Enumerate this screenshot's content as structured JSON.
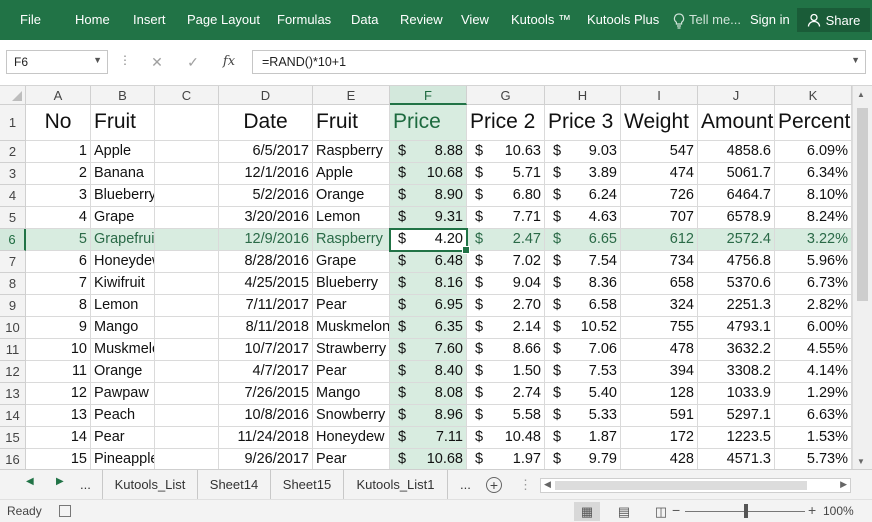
{
  "ribbon": {
    "tabs": [
      "File",
      "Home",
      "Insert",
      "Page Layout",
      "Formulas",
      "Data",
      "Review",
      "View",
      "Kutools ™",
      "Kutools Plus"
    ],
    "tell_me": "Tell me...",
    "sign_in": "Sign in",
    "share": "Share"
  },
  "formula_bar": {
    "name_box": "F6",
    "formula": "=RAND()*10+1"
  },
  "grid": {
    "columns": [
      "A",
      "B",
      "C",
      "D",
      "E",
      "F",
      "G",
      "H",
      "I",
      "J",
      "K"
    ],
    "row_numbers": [
      "1",
      "2",
      "3",
      "4",
      "5",
      "6",
      "7",
      "8",
      "9",
      "10",
      "11",
      "12",
      "13",
      "14",
      "15",
      "16"
    ],
    "selected_column": "F",
    "selected_row": "6",
    "headers": [
      "No",
      "Fruit",
      "",
      "Date",
      "Fruit",
      "Price",
      "Price 2",
      "Price 3",
      "Weight",
      "Amount",
      "Percent"
    ],
    "currency_symbol": "$",
    "rows": [
      [
        "1",
        "Apple",
        "",
        "6/5/2017",
        "Raspberry",
        "8.88",
        "10.63",
        "9.03",
        "547",
        "4858.6",
        "6.09%"
      ],
      [
        "2",
        "Banana",
        "",
        "12/1/2016",
        "Apple",
        "10.68",
        "5.71",
        "3.89",
        "474",
        "5061.7",
        "6.34%"
      ],
      [
        "3",
        "Blueberry",
        "",
        "5/2/2016",
        "Orange",
        "8.90",
        "6.80",
        "6.24",
        "726",
        "6464.7",
        "8.10%"
      ],
      [
        "4",
        "Grape",
        "",
        "3/20/2016",
        "Lemon",
        "9.31",
        "7.71",
        "4.63",
        "707",
        "6578.9",
        "8.24%"
      ],
      [
        "5",
        "Grapefruit",
        "",
        "12/9/2016",
        "Raspberry",
        "4.20",
        "2.47",
        "6.65",
        "612",
        "2572.4",
        "3.22%"
      ],
      [
        "6",
        "Honeydew",
        "",
        "8/28/2016",
        "Grape",
        "6.48",
        "7.02",
        "7.54",
        "734",
        "4756.8",
        "5.96%"
      ],
      [
        "7",
        "Kiwifruit",
        "",
        "4/25/2015",
        "Blueberry",
        "8.16",
        "9.04",
        "8.36",
        "658",
        "5370.6",
        "6.73%"
      ],
      [
        "8",
        "Lemon",
        "",
        "7/11/2017",
        "Pear",
        "6.95",
        "2.70",
        "6.58",
        "324",
        "2251.3",
        "2.82%"
      ],
      [
        "9",
        "Mango",
        "",
        "8/11/2018",
        "Muskmelon",
        "6.35",
        "2.14",
        "10.52",
        "755",
        "4793.1",
        "6.00%"
      ],
      [
        "10",
        "Muskmelon",
        "",
        "10/7/2017",
        "Strawberry",
        "7.60",
        "8.66",
        "7.06",
        "478",
        "3632.2",
        "4.55%"
      ],
      [
        "11",
        "Orange",
        "",
        "4/7/2017",
        "Pear",
        "8.40",
        "1.50",
        "7.53",
        "394",
        "3308.2",
        "4.14%"
      ],
      [
        "12",
        "Pawpaw",
        "",
        "7/26/2015",
        "Mango",
        "8.08",
        "2.74",
        "5.40",
        "128",
        "1033.9",
        "1.29%"
      ],
      [
        "13",
        "Peach",
        "",
        "10/8/2016",
        "Snowberry",
        "8.96",
        "5.58",
        "5.33",
        "591",
        "5297.1",
        "6.63%"
      ],
      [
        "14",
        "Pear",
        "",
        "11/24/2018",
        "Honeydew",
        "7.11",
        "10.48",
        "1.87",
        "172",
        "1223.5",
        "1.53%"
      ],
      [
        "15",
        "Pineapple",
        "",
        "9/26/2017",
        "Pear",
        "10.68",
        "1.97",
        "9.79",
        "428",
        "4571.3",
        "5.73%"
      ]
    ]
  },
  "sheets": {
    "tabs": [
      "Kutools_List",
      "Sheet14",
      "Sheet15",
      "Kutools_List1"
    ],
    "more": "..."
  },
  "status": {
    "ready": "Ready",
    "zoom": "100%"
  },
  "colors": {
    "accent": "#217346",
    "selection_fill": "#d8ece0"
  }
}
